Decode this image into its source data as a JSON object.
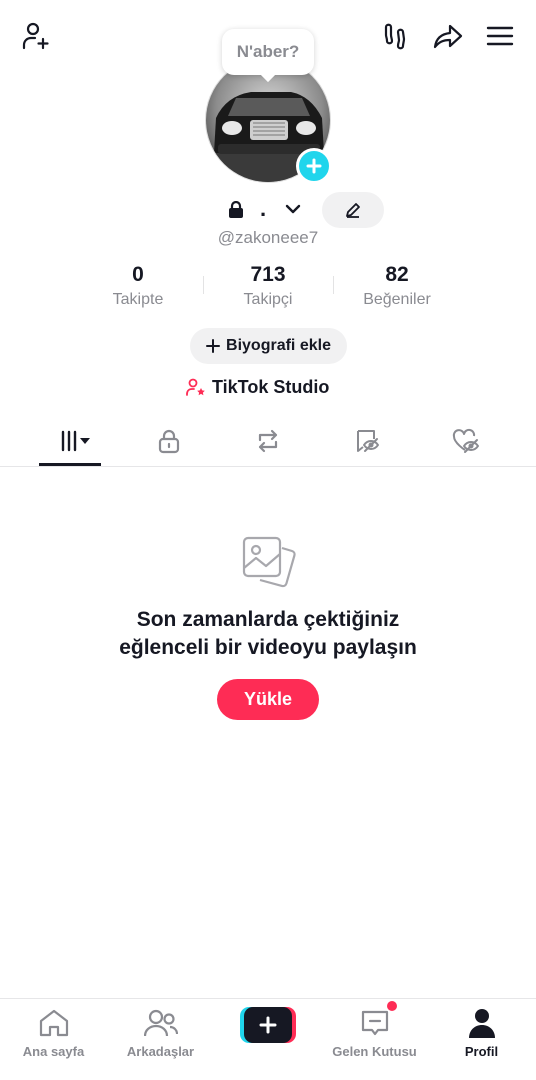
{
  "profile": {
    "speech_bubble": "N'aber?",
    "display_name": ".",
    "username": "@zakoneee7"
  },
  "stats": [
    {
      "value": "0",
      "label": "Takipte"
    },
    {
      "value": "713",
      "label": "Takipçi"
    },
    {
      "value": "82",
      "label": "Beğeniler"
    }
  ],
  "actions": {
    "bio_button": "Biyografi ekle",
    "studio_link": "TikTok Studio"
  },
  "tabs": [
    "videos-grid",
    "private",
    "reposts",
    "favorites",
    "liked"
  ],
  "empty_state": {
    "line1": "Son zamanlarda çektiğiniz",
    "line2": "eğlenceli bir videoyu paylaşın",
    "upload_button": "Yükle"
  },
  "bottom_nav": [
    {
      "label": "Ana sayfa",
      "icon": "home-icon"
    },
    {
      "label": "Arkadaşlar",
      "icon": "friends-icon"
    },
    {
      "label": "",
      "icon": "create-plus-icon"
    },
    {
      "label": "Gelen Kutusu",
      "icon": "inbox-icon"
    },
    {
      "label": "Profil",
      "icon": "profile-icon"
    }
  ],
  "colors": {
    "accent": "#fe2c55",
    "cyan": "#20d5ec",
    "text": "#161823",
    "muted": "#8a8b91"
  }
}
